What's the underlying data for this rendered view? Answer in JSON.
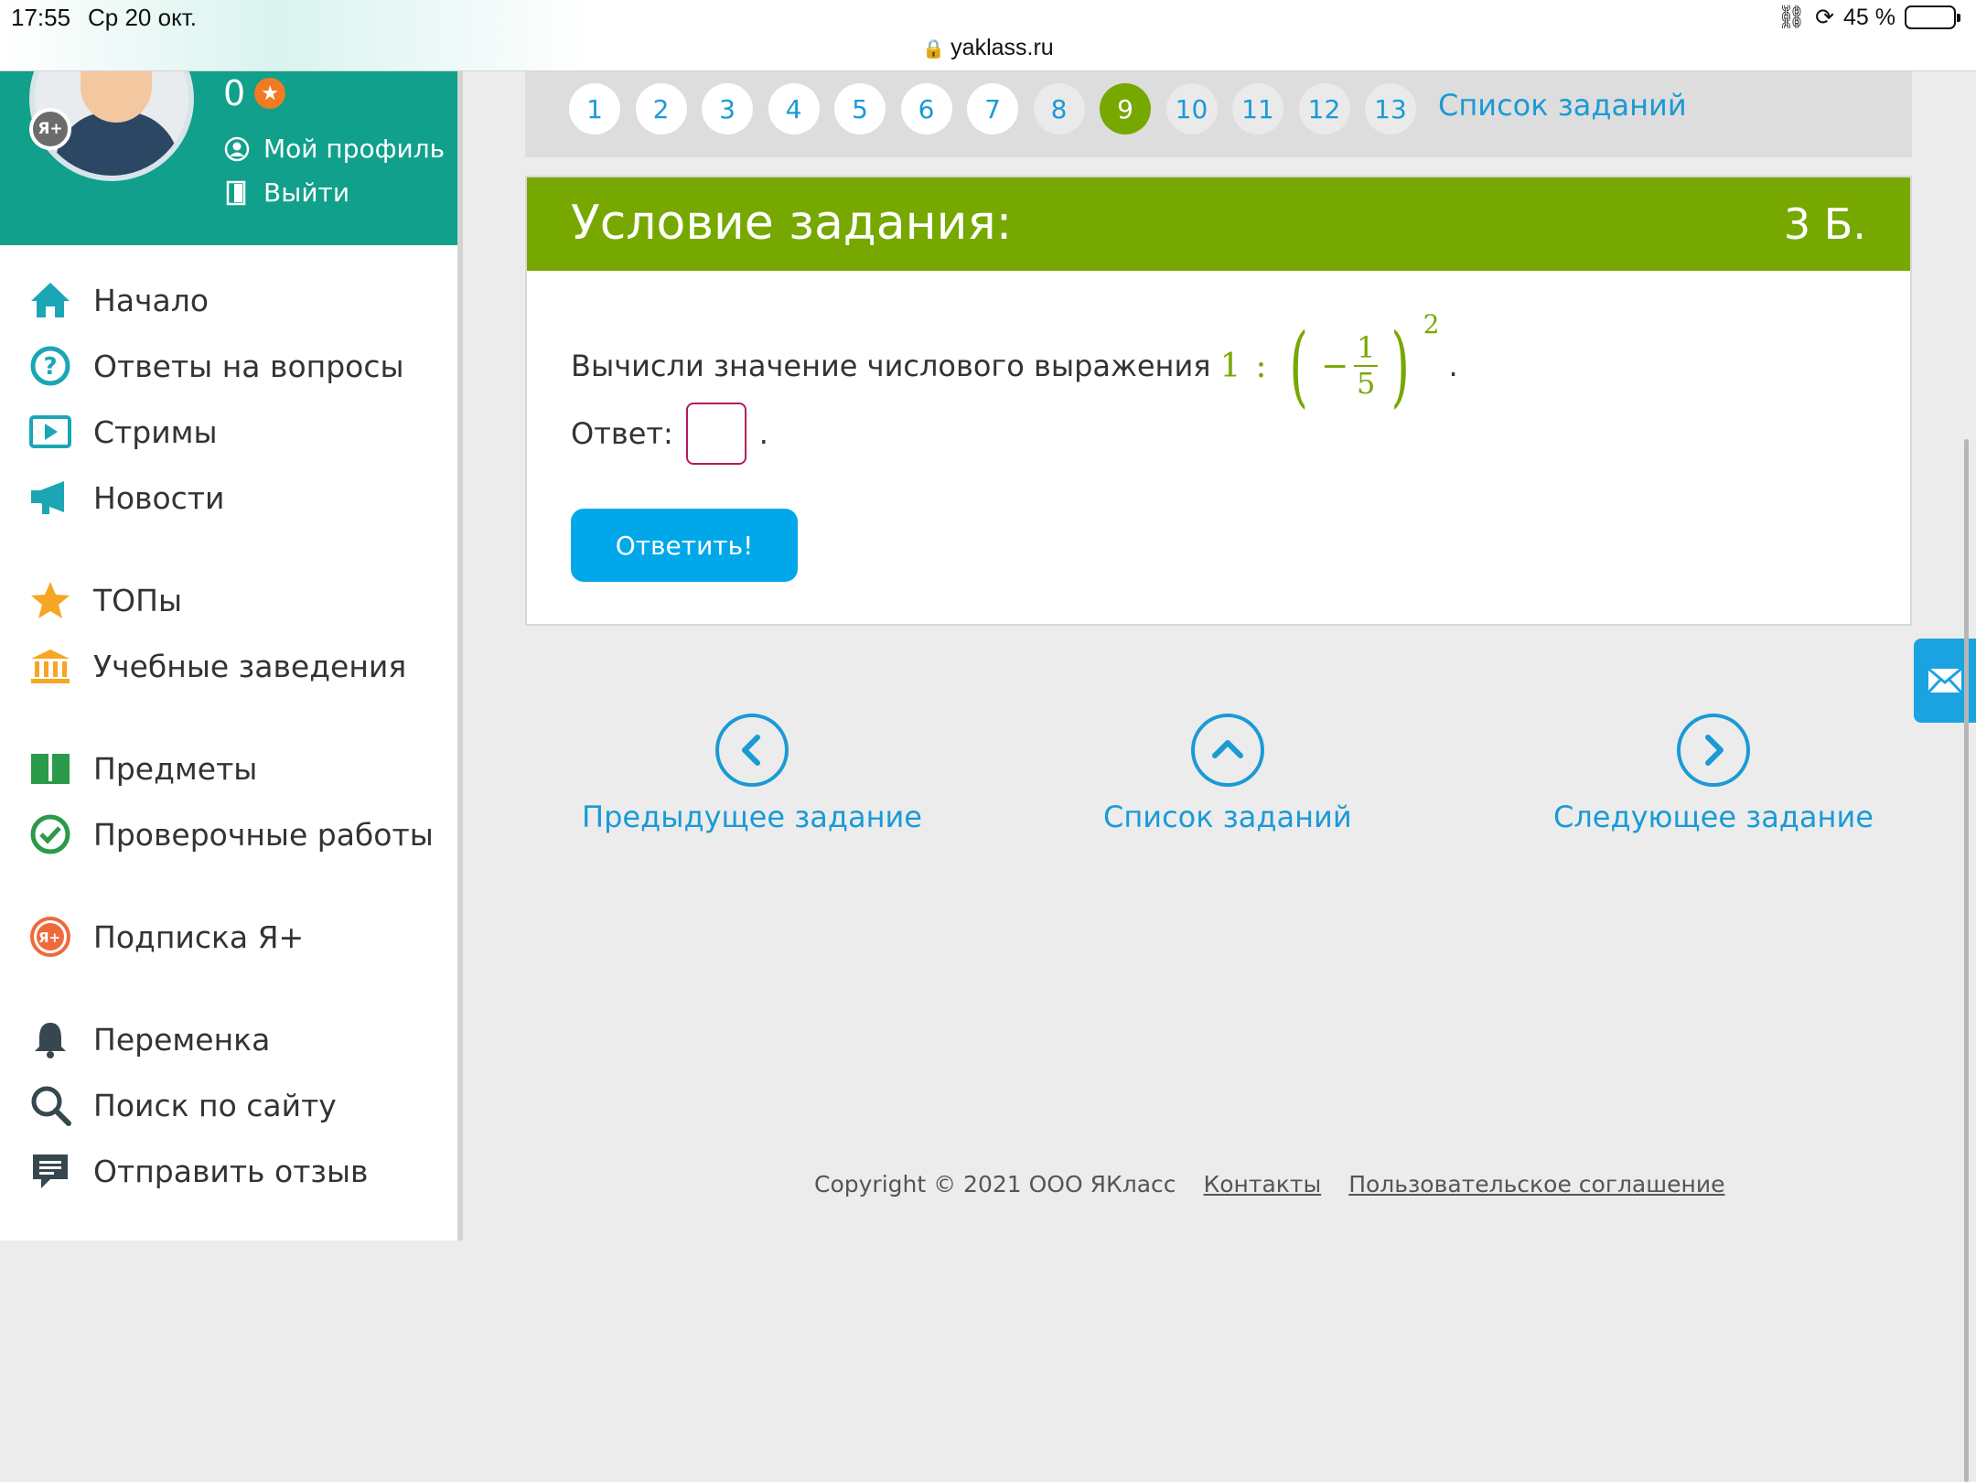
{
  "status_bar": {
    "time": "17:55",
    "date": "Ср 20 окт.",
    "url": "yaklass.ru",
    "battery": "45 %",
    "battery_level": 0.45
  },
  "profile": {
    "points": "0",
    "badge": "Я+",
    "my_profile": "Мой профиль",
    "logout": "Выйти"
  },
  "nav": {
    "items": [
      {
        "label": "Начало",
        "icon": "home-icon"
      },
      {
        "label": "Ответы на вопросы",
        "icon": "question-icon"
      },
      {
        "label": "Стримы",
        "icon": "play-icon"
      },
      {
        "label": "Новости",
        "icon": "megaphone-icon"
      },
      {
        "label": "ТОПы",
        "icon": "star-icon"
      },
      {
        "label": "Учебные заведения",
        "icon": "school-icon"
      },
      {
        "label": "Предметы",
        "icon": "book-icon"
      },
      {
        "label": "Проверочные работы",
        "icon": "check-icon"
      },
      {
        "label": "Подписка Я+",
        "icon": "ya-plus-icon"
      },
      {
        "label": "Переменка",
        "icon": "bell-icon"
      },
      {
        "label": "Поиск по сайту",
        "icon": "search-icon"
      },
      {
        "label": "Отправить отзыв",
        "icon": "feedback-icon"
      }
    ]
  },
  "task_nav": {
    "numbers": [
      "1",
      "2",
      "3",
      "4",
      "5",
      "6",
      "7",
      "8",
      "9",
      "10",
      "11",
      "12",
      "13"
    ],
    "current": "9",
    "list_label": "Список заданий"
  },
  "task": {
    "title": "Условие задания:",
    "points": "3 Б.",
    "question": "Вычисли значение числового выражения",
    "math": {
      "dividend": "1",
      "op": ":",
      "sign": "−",
      "numerator": "1",
      "denominator": "5",
      "exponent": "2",
      "end": "."
    },
    "answer_label": "Ответ:",
    "answer_value": "",
    "answer_end": ".",
    "submit": "Ответить!"
  },
  "bottom_nav": {
    "prev": "Предыдущее задание",
    "list": "Список заданий",
    "next": "Следующее задание"
  },
  "footer": {
    "copyright": "Copyright © 2021 ООО ЯКласс",
    "contacts": "Контакты",
    "agreement": "Пользовательское соглашение"
  },
  "colors": {
    "accent_green": "#77a800",
    "teal": "#10a08b",
    "link_blue": "#1a9ad6",
    "button_blue": "#00a8ea"
  }
}
